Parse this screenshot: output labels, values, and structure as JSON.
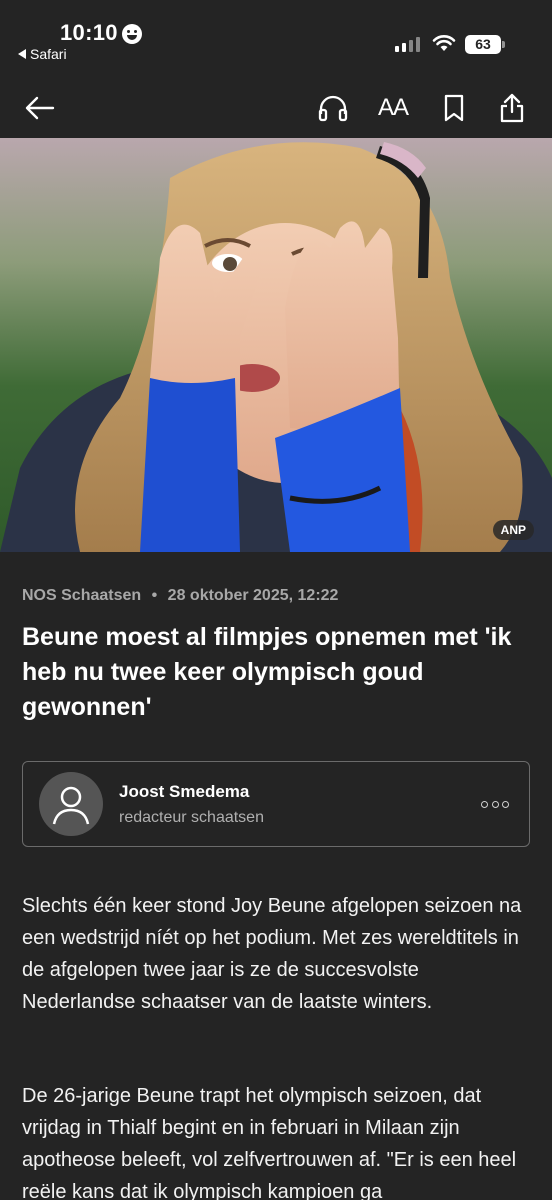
{
  "status_bar": {
    "time": "10:10",
    "back_app": "Safari",
    "battery": "63"
  },
  "toolbar": {
    "back_icon": "arrow-left-icon",
    "audio_icon": "headphones-icon",
    "text_size_label": "AA",
    "bookmark_icon": "bookmark-icon",
    "share_icon": "share-icon"
  },
  "hero": {
    "photo_credit": "ANP"
  },
  "article": {
    "source": "NOS Schaatsen",
    "separator": "•",
    "date": "28 oktober 2025, 12:22",
    "headline": "Beune moest al filmpjes opnemen met 'ik heb nu twee keer olympisch goud gewonnen'",
    "author": {
      "name": "Joost Smedema",
      "role": "redacteur schaatsen",
      "avatar_icon": "person-icon",
      "more_icon": "more-options-icon"
    },
    "paragraphs": [
      "Slechts één keer stond Joy Beune afgelopen seizoen na een wedstrijd níét op het podium. Met zes wereldtitels in de afgelopen twee jaar is ze de succesvolste Nederlandse schaatser van de laatste winters.",
      "De 26-jarige Beune trapt het olympisch seizoen, dat vrijdag in Thialf begint en in februari in Milaan zijn apotheose beleeft, vol zelfvertrouwen af. \"Er is een heel reële kans dat ik olympisch kampioen ga"
    ]
  },
  "colors": {
    "background": "#242424",
    "text": "#ffffff",
    "meta": "#a8a8a8",
    "card_border": "#6b6b6b"
  }
}
